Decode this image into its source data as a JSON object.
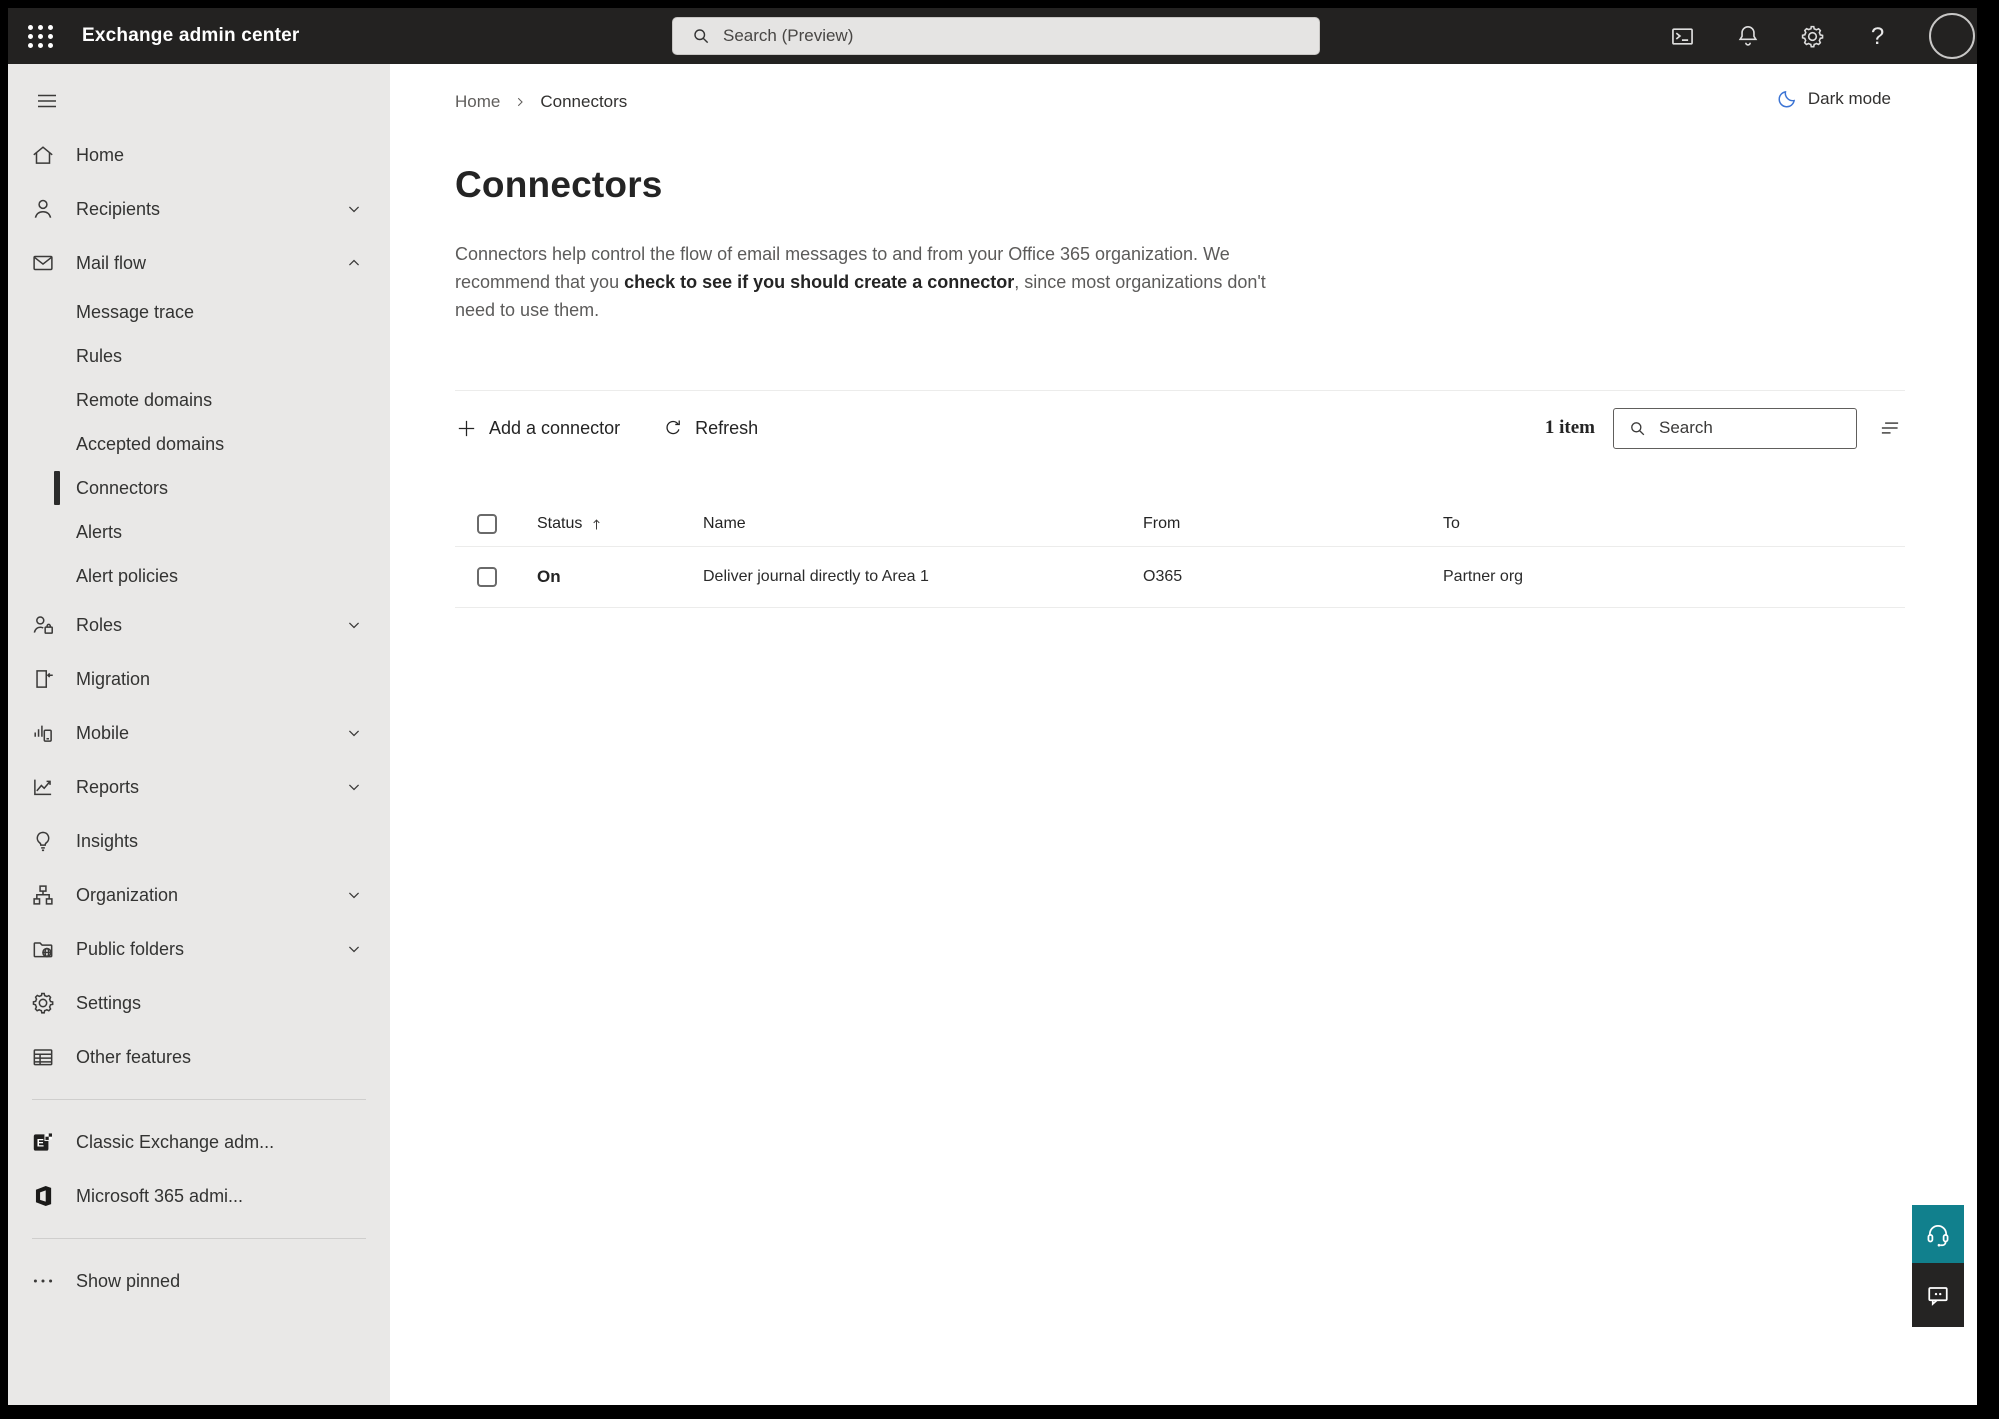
{
  "topbar": {
    "title": "Exchange admin center",
    "search_placeholder": "Search (Preview)",
    "icons": [
      "terminal-icon",
      "bell-icon",
      "gear-icon",
      "help-icon",
      "avatar"
    ]
  },
  "sidebar": {
    "items": [
      {
        "label": "Home",
        "icon": "home-icon"
      },
      {
        "label": "Recipients",
        "icon": "person-icon",
        "chevron": "down"
      },
      {
        "label": "Mail flow",
        "icon": "mail-icon",
        "chevron": "up",
        "expanded": true
      },
      {
        "label": "Message trace",
        "sub": true
      },
      {
        "label": "Rules",
        "sub": true
      },
      {
        "label": "Remote domains",
        "sub": true
      },
      {
        "label": "Accepted domains",
        "sub": true
      },
      {
        "label": "Connectors",
        "sub": true,
        "selected": true
      },
      {
        "label": "Alerts",
        "sub": true
      },
      {
        "label": "Alert policies",
        "sub": true
      },
      {
        "label": "Roles",
        "icon": "roles-icon",
        "chevron": "down"
      },
      {
        "label": "Migration",
        "icon": "migration-icon"
      },
      {
        "label": "Mobile",
        "icon": "mobile-icon",
        "chevron": "down"
      },
      {
        "label": "Reports",
        "icon": "reports-icon",
        "chevron": "down"
      },
      {
        "label": "Insights",
        "icon": "lightbulb-icon"
      },
      {
        "label": "Organization",
        "icon": "org-chart-icon",
        "chevron": "down"
      },
      {
        "label": "Public folders",
        "icon": "folder-globe-icon",
        "chevron": "down"
      },
      {
        "label": "Settings",
        "icon": "gear-icon"
      },
      {
        "label": "Other features",
        "icon": "table-icon"
      },
      {
        "label": "Classic Exchange adm...",
        "icon": "exchange-logo"
      },
      {
        "label": "Microsoft 365 admi...",
        "icon": "m365-logo"
      },
      {
        "label": "Show pinned",
        "icon": "ellipsis-icon"
      }
    ]
  },
  "breadcrumb": {
    "home": "Home",
    "current": "Connectors"
  },
  "darkmode_label": "Dark mode",
  "page": {
    "title": "Connectors",
    "desc_p1": "Connectors help control the flow of email messages to and from your Office 365 organization. We recommend that you ",
    "desc_link": "check to see if you should create a connector",
    "desc_p2": ", since most organizations don't need to use them."
  },
  "toolbar": {
    "add_label": "Add a connector",
    "refresh_label": "Refresh",
    "item_count": "1 item",
    "search_placeholder": "Search"
  },
  "table": {
    "headers": {
      "status": "Status",
      "name": "Name",
      "from": "From",
      "to": "To"
    },
    "rows": [
      {
        "status": "On",
        "name": "Deliver journal directly to Area 1",
        "from": "O365",
        "to": "Partner org"
      }
    ]
  },
  "colors": {
    "topbar_bg": "#232221",
    "sidebar_bg": "#e9e8e7",
    "selected_indicator": "#2b2b2b",
    "moon_blue": "#3c74d4",
    "help_teal": "#11808d",
    "feedback_dark": "#252423"
  }
}
